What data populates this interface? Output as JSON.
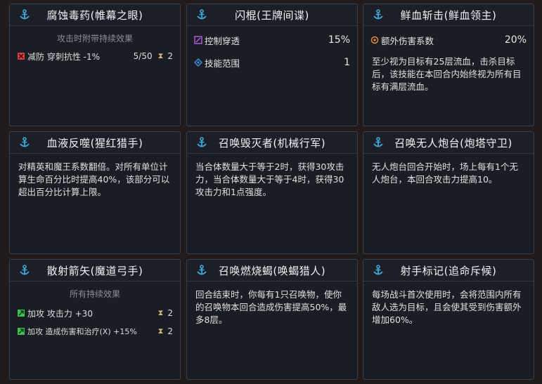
{
  "cards": [
    {
      "title": "腐蚀毒药(帷幕之眼)",
      "subtitle": "攻击时附带持续效果",
      "effects": [
        {
          "icon": "armor-break-icon",
          "text": "减防 穿刺抗性 -1%",
          "count": "5/50",
          "duration": "2"
        }
      ]
    },
    {
      "title": "闪棍(王牌间谍)",
      "stats": [
        {
          "icon": "control-pierce-icon",
          "label": "控制穿透",
          "value": "15%"
        },
        {
          "icon": "skill-range-icon",
          "label": "技能范围",
          "value": "1"
        }
      ]
    },
    {
      "title": "鲜血斩击(鲜血领主)",
      "stats": [
        {
          "icon": "extra-damage-icon",
          "label": "额外伤害系数",
          "value": "20%"
        }
      ],
      "description": "至少视为目标有25层流血，击杀目标后，该技能在本回合内始终视为所有目标有满层流血。"
    },
    {
      "title": "血液反噬(猩红猎手)",
      "description": "对精英和魔王系数翻倍。对所有单位计算生命百分比时提高40%，该部分可以超出百分比计算上限。"
    },
    {
      "title": "召唤毁灭者(机械行军)",
      "description": "当合体数量大于等于2时，获得30攻击力，当合体数量大于等于4时，获得30攻击力和1点强度。"
    },
    {
      "title": "召唤无人炮台(炮塔守卫)",
      "description": "无人炮台回合开始时，场上每有1个无人炮台，本回合攻击力提高10。"
    },
    {
      "title": "散射箭矢(魔道弓手)",
      "subtitle": "所有持续效果",
      "effects": [
        {
          "icon": "attack-up-icon",
          "text": "加攻 攻击力 +30",
          "count": "",
          "duration": "2"
        },
        {
          "icon": "attack-up-icon",
          "text": "加攻 造成伤害和治疗(X) +15%",
          "count": "",
          "duration": "2"
        }
      ]
    },
    {
      "title": "召唤燃烧蝎(唤蝎猎人)",
      "description": "回合结束时，你每有1只召唤物，使你的召唤物本回合造成伤害提高50%，最多8层。"
    },
    {
      "title": "射手标记(追命斥候)",
      "description": "每场战斗首次使用时，会将范围内所有敌人选为目标，且会使其受到伤害额外增加60%。"
    }
  ],
  "colors": {
    "anchor": "#3fa9d9",
    "armor_break": "#d94040",
    "attack_up": "#3fbf4f",
    "control_pierce": "#b05ad9",
    "skill_range": "#3a8fe0",
    "extra_damage": "#e08a3a",
    "hourglass": "#d8b87a"
  }
}
